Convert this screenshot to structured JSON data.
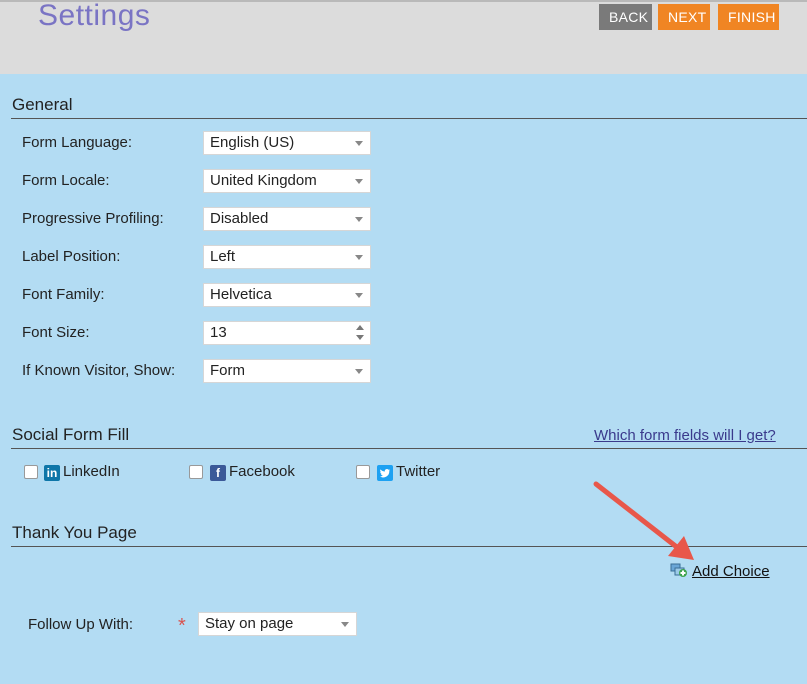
{
  "header": {
    "title": "Settings",
    "back_label": "BACK",
    "next_label": "NEXT",
    "finish_label": "FINISH",
    "accent_color": "#f08523"
  },
  "general": {
    "title": "General",
    "rows": [
      {
        "label": "Form Language:",
        "value": "English (US)"
      },
      {
        "label": "Form Locale:",
        "value": "United Kingdom"
      },
      {
        "label": "Progressive Profiling:",
        "value": "Disabled"
      },
      {
        "label": "Label Position:",
        "value": "Left"
      },
      {
        "label": "Font Family:",
        "value": "Helvetica"
      },
      {
        "label": "Font Size:",
        "value": "13"
      },
      {
        "label": "If Known Visitor, Show:",
        "value": "Form"
      }
    ]
  },
  "social": {
    "title": "Social Form Fill",
    "help_link": "Which form fields will I get?",
    "options": [
      {
        "label": "LinkedIn",
        "icon": "linkedin-icon",
        "checked": false
      },
      {
        "label": "Facebook",
        "icon": "facebook-icon",
        "checked": false
      },
      {
        "label": "Twitter",
        "icon": "twitter-icon",
        "checked": false
      }
    ]
  },
  "thank_you": {
    "title": "Thank You Page",
    "add_choice": "Add Choice",
    "follow_up_label": "Follow Up With:",
    "follow_up_value": "Stay on page",
    "required_mark": "*"
  }
}
